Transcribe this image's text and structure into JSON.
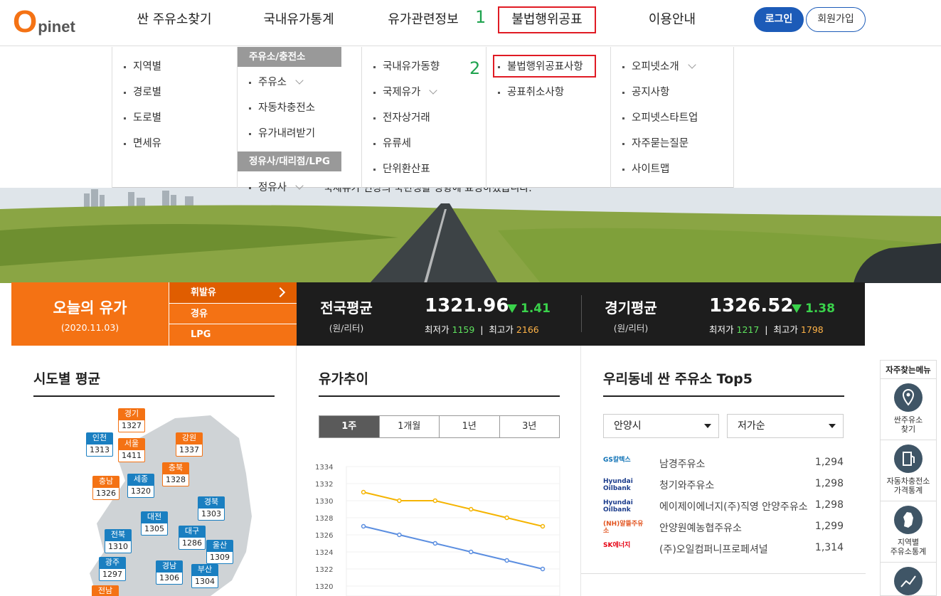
{
  "brand": {
    "logo_o": "O",
    "logo_text": "pinet",
    "primary": "#1c5bb8",
    "accent": "#f47214",
    "highlight": "#e01b24",
    "marker": "#1fa34f"
  },
  "nav": {
    "items": [
      "싼 주유소찾기",
      "국내유가통계",
      "유가관련정보",
      "불법행위공표",
      "이용안내"
    ],
    "marker1": "1",
    "login": "로그인",
    "join": "회원가입"
  },
  "dropdown": {
    "col1": [
      "지역별",
      "경로별",
      "도로별",
      "면세유"
    ],
    "col2_head1": "주유소/충전소",
    "col2": [
      "주유소",
      "자동차충전소",
      "유가내려받기"
    ],
    "col2_head2": "정유사/대리점/LPG",
    "col2_partial": "정유사",
    "col3": [
      "국내유가동향",
      "국제유가",
      "전자상거래",
      "유류세",
      "단위환산표"
    ],
    "marker2": "2",
    "col4": [
      "불법행위공표사항",
      "공표취소사항"
    ],
    "col5": [
      "오피넷소개",
      "공지사항",
      "오피넷스타트업",
      "자주묻는질문",
      "사이트맵"
    ]
  },
  "hero": {
    "caption": "국제유가 인상의 국민생활 영향에 표명하겠습니다."
  },
  "today": {
    "title": "오늘의 유가",
    "date": "(2020.11.03)",
    "fuels": [
      "휘발유",
      "경유",
      "LPG"
    ],
    "national": {
      "label": "전국평균",
      "unit": "(원/리터)",
      "value": "1321.96",
      "change": "1.41",
      "min_label": "최저가",
      "min": "1159",
      "max_label": "최고가",
      "max": "2166"
    },
    "gyeonggi": {
      "label": "경기평균",
      "unit": "(원/리터)",
      "value": "1326.52",
      "change": "1.38",
      "min_label": "최저가",
      "min": "1217",
      "max_label": "최고가",
      "max": "1798"
    }
  },
  "region": {
    "title": "시도별 평균",
    "pins": [
      {
        "name": "경기",
        "value": "1327",
        "color": "orange"
      },
      {
        "name": "인천",
        "value": "1313",
        "color": "blue"
      },
      {
        "name": "서울",
        "value": "1411",
        "color": "orange"
      },
      {
        "name": "강원",
        "value": "1337",
        "color": "orange"
      },
      {
        "name": "충북",
        "value": "1328",
        "color": "orange"
      },
      {
        "name": "충남",
        "value": "1326",
        "color": "orange"
      },
      {
        "name": "세종",
        "value": "1320",
        "color": "blue"
      },
      {
        "name": "경북",
        "value": "1303",
        "color": "blue"
      },
      {
        "name": "대전",
        "value": "1305",
        "color": "blue"
      },
      {
        "name": "전북",
        "value": "1310",
        "color": "blue"
      },
      {
        "name": "대구",
        "value": "1286",
        "color": "blue"
      },
      {
        "name": "울산",
        "value": "1309",
        "color": "blue"
      },
      {
        "name": "광주",
        "value": "1297",
        "color": "blue"
      },
      {
        "name": "경남",
        "value": "1306",
        "color": "blue"
      },
      {
        "name": "부산",
        "value": "1304",
        "color": "blue"
      },
      {
        "name": "전남",
        "value": "",
        "color": "orange"
      }
    ]
  },
  "trend": {
    "title": "유가추이",
    "tabs": [
      "1주",
      "1개월",
      "1년",
      "3년"
    ],
    "active_tab": 0
  },
  "chart_data": {
    "type": "line",
    "x": [
      1,
      2,
      3,
      4,
      5,
      6
    ],
    "ylim": [
      1320,
      1334
    ],
    "yticks": [
      "1334",
      "1332",
      "1330",
      "1328",
      "1326",
      "1324",
      "1322",
      "1320"
    ],
    "series": [
      {
        "color": "#f5b400",
        "values": [
          1331.0,
          1330.0,
          1330.0,
          1329.0,
          1328.0,
          1327.0
        ]
      },
      {
        "color": "#5b8ee0",
        "values": [
          1327.0,
          1326.0,
          1325.0,
          1324.0,
          1323.0,
          1322.0
        ]
      }
    ]
  },
  "top5": {
    "title": "우리동네 싼 주유소 Top5",
    "city": "안양시",
    "sort": "저가순",
    "stations": [
      {
        "brand": "GS칼텍스",
        "name": "남경주유소",
        "price": "1,294"
      },
      {
        "brand": "Hyundai Oilbank",
        "name": "청기와주유소",
        "price": "1,298"
      },
      {
        "brand": "Hyundai Oilbank",
        "name": "에이제이에너지(주)직영 안양주유소",
        "price": "1,298"
      },
      {
        "brand": "(NH)알뜰주유소",
        "name": "안양원예농협주유소",
        "price": "1,299"
      },
      {
        "brand": "SK에너지",
        "name": "(주)오일컴퍼니프로페셔널",
        "price": "1,314"
      }
    ]
  },
  "quick": {
    "title": "자주찾는메뉴",
    "items": [
      "싼주유소\n찾기",
      "자동차충전소\n가격통계",
      "지역별\n주유소통계"
    ]
  }
}
